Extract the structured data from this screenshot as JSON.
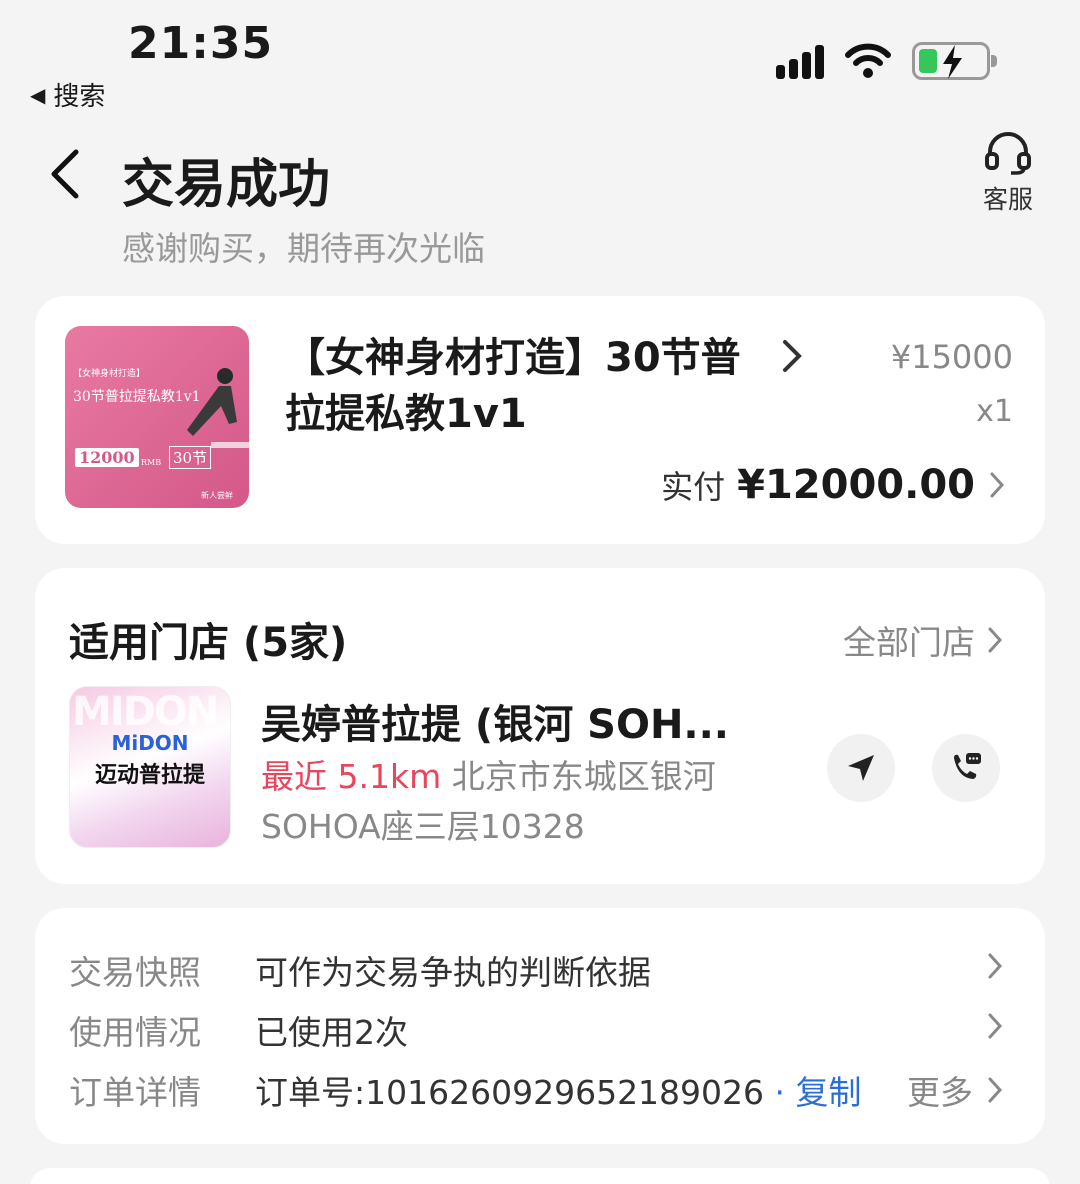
{
  "status_bar": {
    "time": "21:35",
    "back_app": "搜索"
  },
  "header": {
    "title": "交易成功",
    "subtitle": "感谢购买，期待再次光临",
    "service_label": "客服"
  },
  "product": {
    "title": "【女神身材打造】30节普拉提私教1v1",
    "price": "¥15000",
    "quantity": "x1",
    "paid_label": "实付",
    "paid_amount": "¥12000.00",
    "thumb": {
      "tag": "【女神身材打造】",
      "headline": "30节普拉提私教1v1",
      "price_box": "12000",
      "unit": "RMB",
      "sessions": "30节",
      "corner": "新人尝鲜"
    }
  },
  "stores": {
    "title": "适用门店 (5家)",
    "all_label": "全部门店",
    "store": {
      "name": "吴婷普拉提 (银河 SOH...",
      "distance": "最近 5.1km",
      "address": "北京市东城区银河SOHOA座三层10328",
      "logo_brand": "MiDON",
      "logo_name": "迈动普拉提",
      "logo_bg_text": "MIDON"
    }
  },
  "info_rows": [
    {
      "label": "交易快照",
      "value": "可作为交易争执的判断依据"
    },
    {
      "label": "使用情况",
      "value": "已使用2次"
    },
    {
      "label": "订单详情",
      "value": "订单号:1016260929652189026",
      "copy_label": "· 复制",
      "more_label": "更多"
    }
  ],
  "colors": {
    "accent_red": "#e8455f",
    "link_blue": "#2b6fd6",
    "battery_green": "#35c759"
  }
}
